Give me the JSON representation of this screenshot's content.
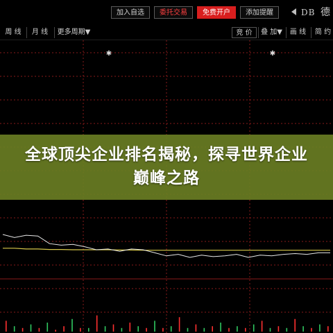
{
  "toolbar": {
    "add_watchlist": "加入自选",
    "entrust_trade": "委托交易",
    "free_account": "免费开户",
    "add_reminder": "添加提醒",
    "symbol_code": "DB",
    "symbol_name": "德"
  },
  "periods": {
    "week": "周 线",
    "month": "月 线",
    "more": "更多周期▼"
  },
  "right_tools": {
    "bid_price": "竞 价",
    "overlay": "叠 加▼",
    "draw_line": "画 线",
    "brief": "简 约"
  },
  "headline": "全球顶尖企业排名揭秘，探寻世界企业巅峰之路",
  "colors": {
    "background": "#000000",
    "grid": "#8a1a1a",
    "price_line": "#e8e8e8",
    "avg_line": "#d8c84a",
    "up_volume": "#ff3030",
    "down_volume": "#30c860",
    "banner": "#687c22"
  },
  "chart_data": {
    "type": "line",
    "series": [
      {
        "values": [
          1.0,
          0.8,
          0.95,
          0.9,
          0.4,
          0.3,
          0.35,
          0.2,
          0.0,
          0.05,
          -0.1,
          0.05,
          0.0,
          -0.2,
          -0.4,
          -0.3,
          -0.5,
          -0.35,
          -0.45,
          -0.4,
          -0.3,
          -0.5,
          -0.35,
          -0.4,
          -0.3,
          -0.25,
          -0.3,
          -0.2,
          -0.2
        ]
      },
      {
        "values": [
          0.1,
          0.1,
          0.05,
          0.05,
          0.02,
          0.02,
          0.0,
          0.0,
          0.0,
          0.0,
          -0.02,
          -0.02,
          -0.03,
          -0.03,
          -0.03,
          -0.03,
          -0.03,
          -0.03,
          -0.03,
          -0.03,
          -0.03,
          -0.03,
          -0.03,
          -0.03,
          -0.03,
          -0.03,
          -0.03,
          -0.03,
          -0.03
        ]
      }
    ],
    "volumes": [
      {
        "v": 6,
        "up": true
      },
      {
        "v": 3,
        "up": false
      },
      {
        "v": 2,
        "up": true
      },
      {
        "v": 4,
        "up": false
      },
      {
        "v": 2,
        "up": true
      },
      {
        "v": 5,
        "up": false
      },
      {
        "v": 1,
        "up": true
      },
      {
        "v": 3,
        "up": true
      },
      {
        "v": 7,
        "up": false
      },
      {
        "v": 2,
        "up": true
      },
      {
        "v": 2,
        "up": false
      },
      {
        "v": 9,
        "up": true
      },
      {
        "v": 3,
        "up": false
      },
      {
        "v": 4,
        "up": true
      },
      {
        "v": 2,
        "up": false
      },
      {
        "v": 5,
        "up": true
      },
      {
        "v": 3,
        "up": false
      },
      {
        "v": 2,
        "up": true
      },
      {
        "v": 6,
        "up": false
      },
      {
        "v": 2,
        "up": true
      },
      {
        "v": 3,
        "up": false
      },
      {
        "v": 8,
        "up": true
      },
      {
        "v": 2,
        "up": false
      },
      {
        "v": 4,
        "up": true
      },
      {
        "v": 2,
        "up": false
      },
      {
        "v": 3,
        "up": true
      },
      {
        "v": 5,
        "up": false
      },
      {
        "v": 2,
        "up": true
      },
      {
        "v": 3,
        "up": false
      },
      {
        "v": 2,
        "up": true
      },
      {
        "v": 4,
        "up": false
      },
      {
        "v": 6,
        "up": true
      },
      {
        "v": 2,
        "up": false
      },
      {
        "v": 3,
        "up": true
      },
      {
        "v": 2,
        "up": false
      },
      {
        "v": 7,
        "up": true
      },
      {
        "v": 3,
        "up": false
      },
      {
        "v": 2,
        "up": true
      },
      {
        "v": 4,
        "up": false
      },
      {
        "v": 3,
        "up": true
      }
    ]
  }
}
